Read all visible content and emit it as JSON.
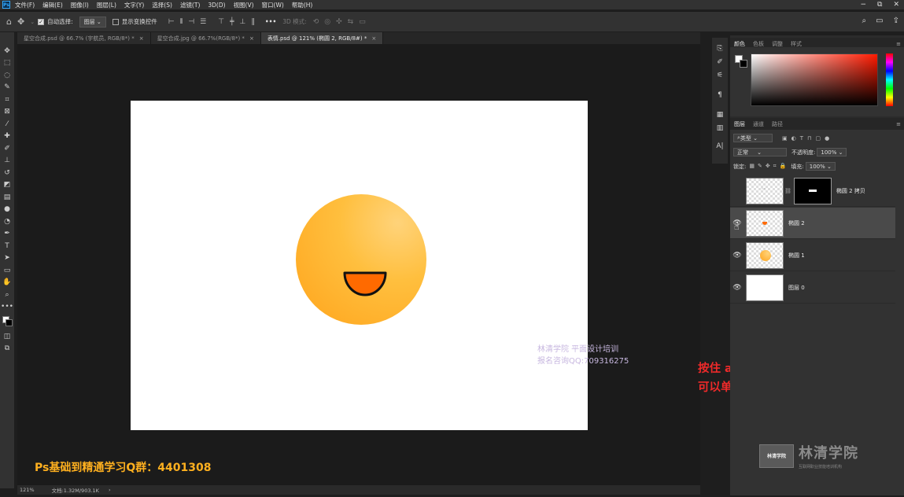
{
  "menubar": {
    "logo": "Ps",
    "items": [
      "文件(F)",
      "编辑(E)",
      "图像(I)",
      "图层(L)",
      "文字(Y)",
      "选择(S)",
      "滤镜(T)",
      "3D(D)",
      "视图(V)",
      "窗口(W)",
      "帮助(H)"
    ],
    "window_controls": [
      "−",
      "⧉",
      "✕"
    ]
  },
  "options": {
    "auto_select_label": "自动选择:",
    "auto_select_value": "图层",
    "show_transform_label": "显示变换控件",
    "three_d_mode": "3D 模式:",
    "more": "•••"
  },
  "tabs": [
    {
      "label": "星空合成.psd @ 66.7% (宇航员, RGB/8*) *",
      "active": false
    },
    {
      "label": "星空合成.jpg @ 66.7%(RGB/8*) *",
      "active": false
    },
    {
      "label": "表情.psd @ 121% (椭圆 2, RGB/8#) *",
      "active": true
    }
  ],
  "canvas": {
    "watermark_line1": "林清学院  平面设计培训",
    "watermark_line2": "报名咨询QQ:709316275",
    "promo": "Ps基础到精通学习Q群：4401308",
    "annotation": "按住 alt 键盘，点击图层的“小眼睛”，可以单独查看图层"
  },
  "status": {
    "zoom": "121%",
    "doc_size": "文档:1.32M/903.1K",
    "arrow": "›"
  },
  "color_panel": {
    "tabs": [
      "颜色",
      "色板",
      "调整",
      "样式"
    ],
    "fg_color": "#ffffff",
    "bg_color": "#000000"
  },
  "layers_panel": {
    "tabs": [
      "图层",
      "通道",
      "路径"
    ],
    "filter_label": "类型",
    "blend_mode": "正常",
    "opacity_label": "不透明度:",
    "opacity_value": "100%",
    "lock_label": "锁定:",
    "fill_label": "填充:",
    "fill_value": "100%",
    "layers": [
      {
        "name": "椭圆 2 拷贝",
        "visible": false,
        "selected": false,
        "has_mask": true
      },
      {
        "name": "椭圆 2",
        "visible": true,
        "selected": true,
        "has_mask": false
      },
      {
        "name": "椭圆 1",
        "visible": true,
        "selected": false,
        "has_mask": false
      },
      {
        "name": "图层 0",
        "visible": true,
        "selected": false,
        "has_mask": false
      }
    ],
    "footer_icons": [
      "link-icon",
      "fx-icon",
      "mask-icon",
      "adjustment-icon",
      "group-icon",
      "new-layer-icon",
      "trash-icon"
    ]
  },
  "branding": {
    "badge": "林清学院",
    "name": "林清学院",
    "tagline": "互联网职业技能培训机构"
  },
  "colors": {
    "smile_fill": "#ff6a00",
    "face_light": "#ffd37a",
    "face_dark": "#ffa41c",
    "annotation": "#f02a2a",
    "promo": "#ffb01f"
  }
}
